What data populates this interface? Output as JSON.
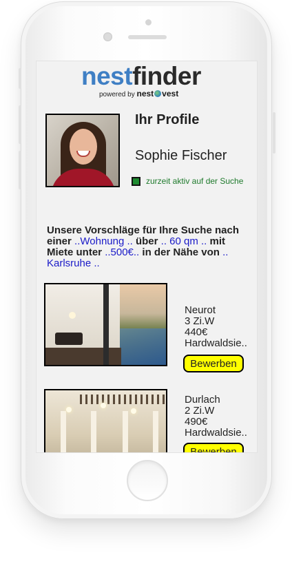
{
  "app": {
    "logo_part1": "nest",
    "logo_part2": "finder",
    "powered_by": "powered by",
    "brand_part1": "nest",
    "brand_part2": "vest",
    "brand_color": "#3f7fc4"
  },
  "profile": {
    "title": "Ihr Profile",
    "name": "Sophie Fischer",
    "status_text": "zurzeit aktiv auf der Suche",
    "status_active": true,
    "status_color": "#1e8a30"
  },
  "suggestions": {
    "t1": "Unsere Vorschläge für Ihre Suche nach einer ",
    "type": "..Wohnung ..",
    "t2": " über ",
    "size": ".. 60 qm ..",
    "t3": " mit Miete unter ",
    "rent": "..500€..",
    "t4": " in der Nähe von ",
    "city": ".. Karlsruhe ..",
    "keyword_color": "#1a1ac8"
  },
  "listings": [
    {
      "city": "Neurot",
      "rooms": "3 Zi.W",
      "price": "440€",
      "street": "Hardwaldsie..",
      "apply_label": "Bewerben",
      "image_icon": "apartment-balcony-photo"
    },
    {
      "city": "Durlach",
      "rooms": "2 Zi.W",
      "price": "490€",
      "street": "Hardwaldsie..",
      "apply_label": "Bewerben",
      "image_icon": "apartment-hall-photo"
    }
  ],
  "apply_button_color": "#ffff00"
}
